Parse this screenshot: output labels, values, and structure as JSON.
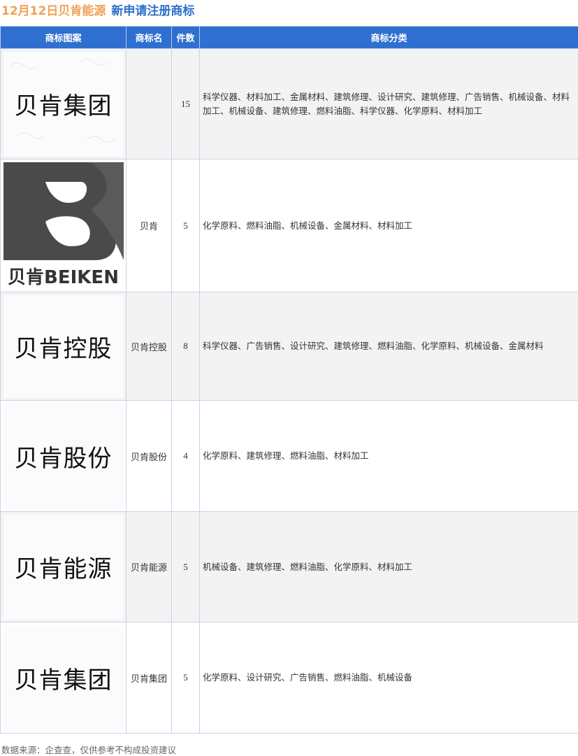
{
  "header": {
    "date_title": "12月12日贝肯能源",
    "subtitle": "新申请注册商标"
  },
  "table": {
    "columns": [
      "商标图案",
      "商标名",
      "件数",
      "商标分类"
    ],
    "rows": [
      {
        "logo_text": "贝肯集团",
        "name": "",
        "count": "15",
        "categories": "科学仪器、材料加工、金属材料、建筑修理、设计研究、建筑修理、广告销售、机械设备、材料加工、机械设备、建筑修理、燃料油脂、科学仪器、化学原料、材料加工"
      },
      {
        "logo_text": "贝肯BEIKEN",
        "name": "贝肯",
        "count": "5",
        "categories": "化学原料、燃料油脂、机械设备、金属材料、材料加工"
      },
      {
        "logo_text": "贝肯控股",
        "name": "贝肯控股",
        "count": "8",
        "categories": "科学仪器、广告销售、设计研究、建筑修理、燃料油脂、化学原料、机械设备、金属材料"
      },
      {
        "logo_text": "贝肯股份",
        "name": "贝肯股份",
        "count": "4",
        "categories": "化学原料、建筑修理、燃料油脂、材料加工"
      },
      {
        "logo_text": "贝肯能源",
        "name": "贝肯能源",
        "count": "5",
        "categories": "机械设备、建筑修理、燃料油脂、化学原料、材料加工"
      },
      {
        "logo_text": "贝肯集团",
        "name": "贝肯集团",
        "count": "5",
        "categories": "化学原料、设计研究、广告销售、燃料油脂、机械设备"
      }
    ]
  },
  "footer": {
    "source": "数据来源：企查查，仅供参考不构成投资建议"
  },
  "colors": {
    "header_bg": "#2f6fd0",
    "date": "#f0a057",
    "subtitle": "#2d6fc9"
  }
}
